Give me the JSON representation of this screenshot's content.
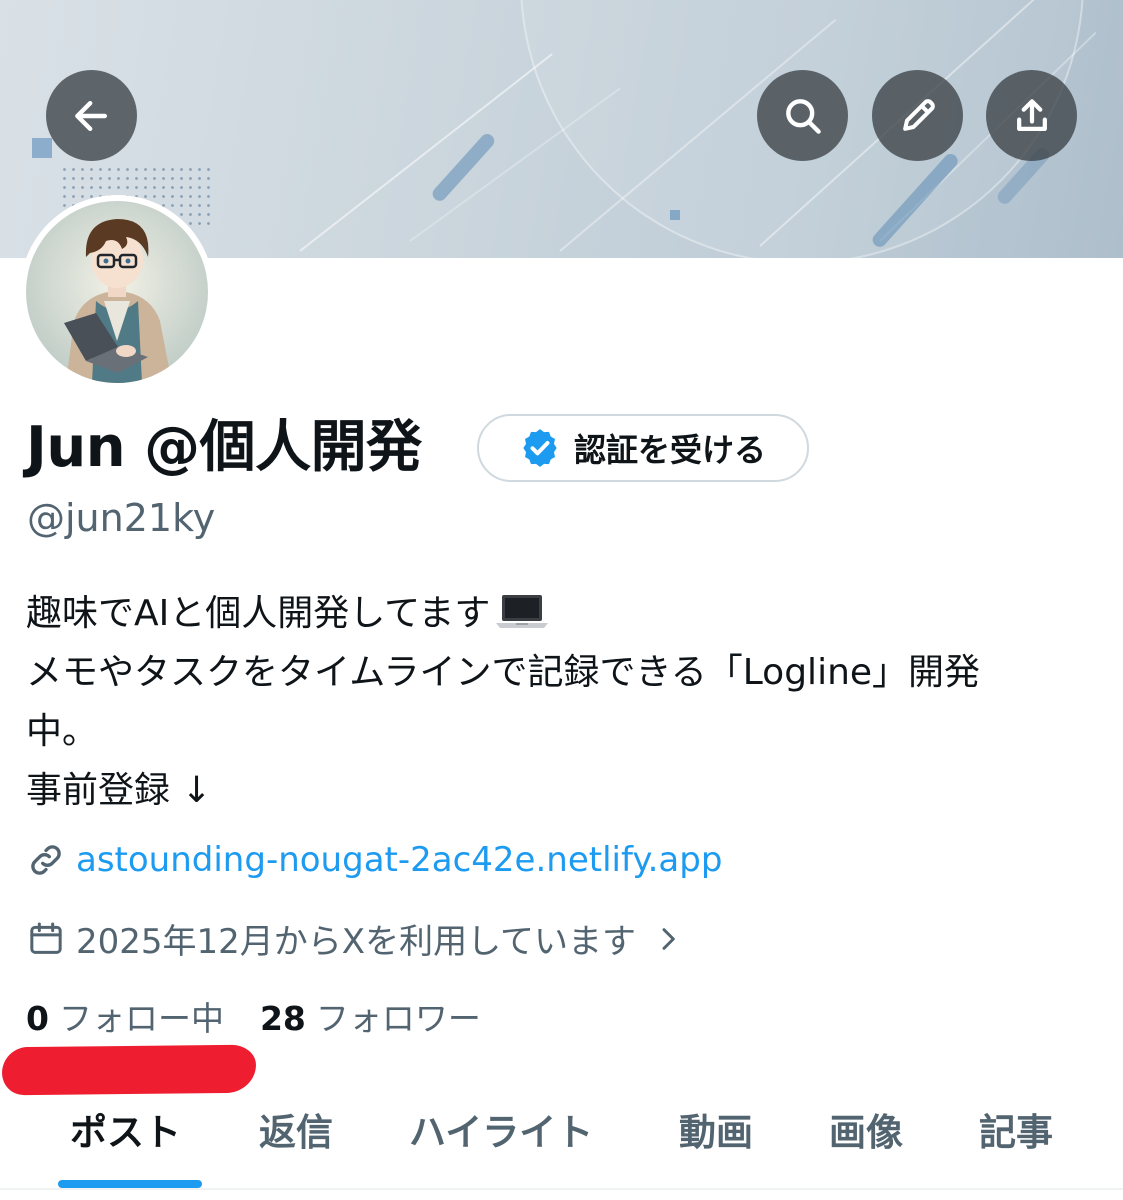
{
  "colors": {
    "accent": "#1d9bf0",
    "text_primary": "#0f1419",
    "text_secondary": "#536471",
    "red_mark": "#ee1d2f"
  },
  "header": {
    "back_icon": "arrow-left-icon",
    "search_icon": "search-icon",
    "edit_icon": "pencil-icon",
    "share_icon": "share-upload-icon"
  },
  "profile": {
    "display_name": "Jun @個人開発",
    "verify_button_label": "認証を受ける",
    "verify_icon": "verified-badge-icon",
    "handle": "@jun21ky",
    "bio_lines": [
      "趣味でAIと個人開発してます",
      "メモやタスクをタイムラインで記録できる「Logline」開発",
      "中。",
      "事前登録 ↓"
    ],
    "bio_emoji": "laptop-icon",
    "link_icon": "link-icon",
    "link_text": "astounding-nougat-2ac42e.netlify.app",
    "joined_icon": "calendar-icon",
    "joined_text": "2025年12月からXを利用しています",
    "following_count": "0",
    "following_label": "フォロー中",
    "followers_count": "28",
    "followers_label": "フォロワー"
  },
  "tabs": [
    {
      "label": "ポスト",
      "active": true
    },
    {
      "label": "返信",
      "active": false
    },
    {
      "label": "ハイライト",
      "active": false
    },
    {
      "label": "動画",
      "active": false
    },
    {
      "label": "画像",
      "active": false
    },
    {
      "label": "記事",
      "active": false
    }
  ]
}
